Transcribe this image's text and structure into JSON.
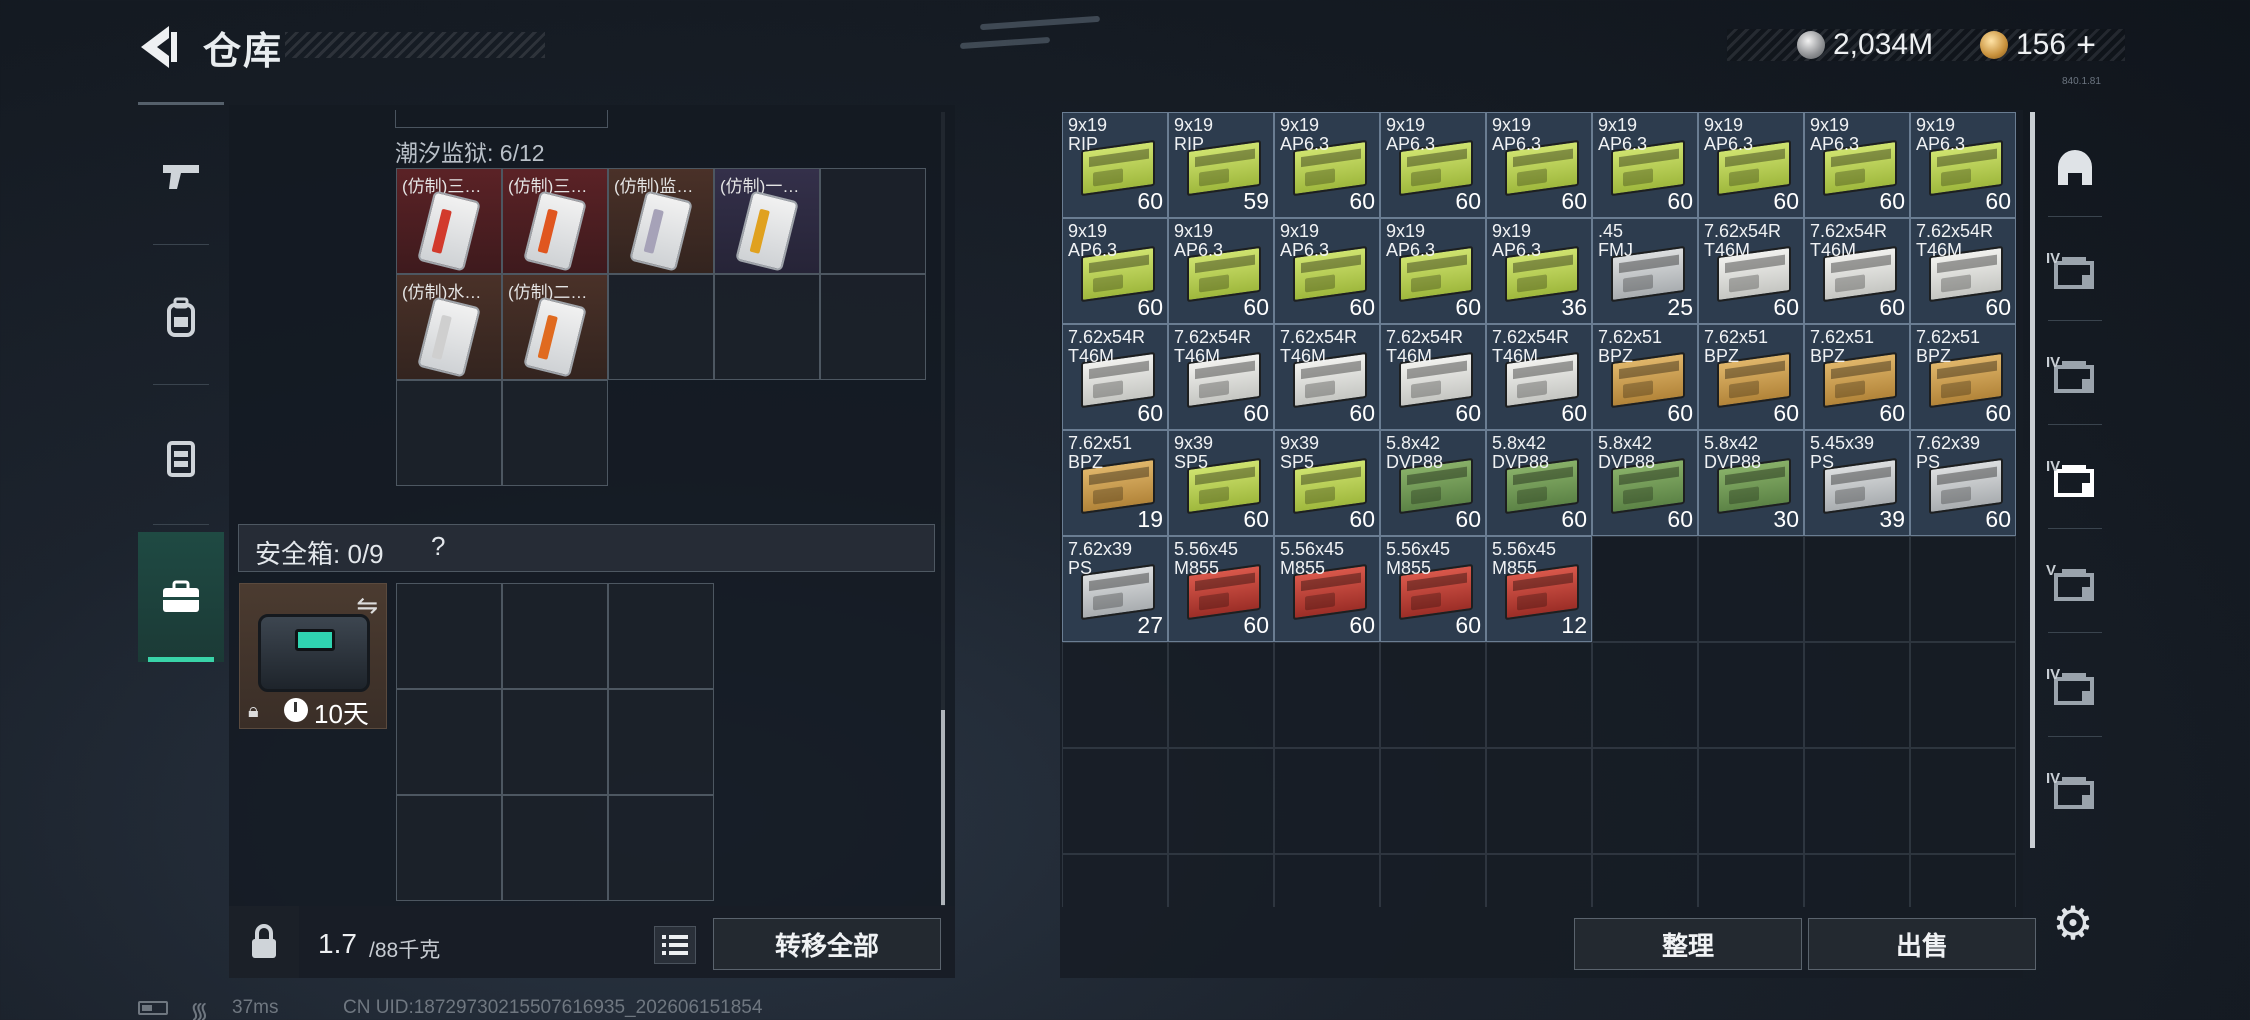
{
  "header": {
    "title": "仓库",
    "currencies": {
      "silver": "2,034M",
      "gold": "156",
      "plus": "+"
    },
    "version": "840.1.81"
  },
  "left_rail": {
    "tabs": [
      {
        "icon": "pistol-icon",
        "active": false
      },
      {
        "icon": "backpack-icon",
        "active": false
      },
      {
        "icon": "chest-rig-icon",
        "active": false
      },
      {
        "icon": "briefcase-icon",
        "active": true
      }
    ]
  },
  "container": {
    "label": "潮汐监狱: 6/12",
    "items": [
      {
        "name": "(仿制)三…",
        "bg": "red",
        "strip": "#d23a2c"
      },
      {
        "name": "(仿制)三…",
        "bg": "red",
        "strip": "#e0561f"
      },
      {
        "name": "(仿制)监…",
        "bg": "brown",
        "strip": "#a6a2b8"
      },
      {
        "name": "(仿制)一…",
        "bg": "purple",
        "strip": "#e0a11f"
      },
      {
        "name": "(仿制)水…",
        "bg": "brown",
        "strip": "#cfcfcf"
      },
      {
        "name": "(仿制)二…",
        "bg": "brown",
        "strip": "#e06a1f"
      }
    ]
  },
  "safe_box": {
    "label": "安全箱: 0/9",
    "help": "?",
    "timer": "10天",
    "swap_icon": "swap-icon",
    "lock_icon": "lock-icon"
  },
  "weight": {
    "value": "1.7",
    "max": "/88千克"
  },
  "buttons": {
    "transfer_all": "转移全部",
    "sort": "整理",
    "sell": "出售"
  },
  "ammo_items": [
    {
      "cal": "9x19",
      "var": "RIP",
      "count": "60",
      "color": "lime"
    },
    {
      "cal": "9x19",
      "var": "RIP",
      "count": "59",
      "color": "lime"
    },
    {
      "cal": "9x19",
      "var": "AP6.3",
      "count": "60",
      "color": "lime"
    },
    {
      "cal": "9x19",
      "var": "AP6.3",
      "count": "60",
      "color": "lime"
    },
    {
      "cal": "9x19",
      "var": "AP6.3",
      "count": "60",
      "color": "lime"
    },
    {
      "cal": "9x19",
      "var": "AP6.3",
      "count": "60",
      "color": "lime"
    },
    {
      "cal": "9x19",
      "var": "AP6.3",
      "count": "60",
      "color": "lime"
    },
    {
      "cal": "9x19",
      "var": "AP6.3",
      "count": "60",
      "color": "lime"
    },
    {
      "cal": "9x19",
      "var": "AP6.3",
      "count": "60",
      "color": "lime"
    },
    {
      "cal": "9x19",
      "var": "AP6.3",
      "count": "60",
      "color": "lime"
    },
    {
      "cal": "9x19",
      "var": "AP6.3",
      "count": "60",
      "color": "lime"
    },
    {
      "cal": "9x19",
      "var": "AP6.3",
      "count": "60",
      "color": "lime"
    },
    {
      "cal": "9x19",
      "var": "AP6.3",
      "count": "60",
      "color": "lime"
    },
    {
      "cal": "9x19",
      "var": "AP6.3",
      "count": "36",
      "color": "lime"
    },
    {
      "cal": ".45",
      "var": "FMJ",
      "count": "25",
      "color": "grey"
    },
    {
      "cal": "7.62x54R",
      "var": "T46M",
      "count": "60",
      "color": "white"
    },
    {
      "cal": "7.62x54R",
      "var": "T46M",
      "count": "60",
      "color": "white"
    },
    {
      "cal": "7.62x54R",
      "var": "T46M",
      "count": "60",
      "color": "white"
    },
    {
      "cal": "7.62x54R",
      "var": "T46M",
      "count": "60",
      "color": "white"
    },
    {
      "cal": "7.62x54R",
      "var": "T46M",
      "count": "60",
      "color": "white"
    },
    {
      "cal": "7.62x54R",
      "var": "T46M",
      "count": "60",
      "color": "white"
    },
    {
      "cal": "7.62x54R",
      "var": "T46M",
      "count": "60",
      "color": "white"
    },
    {
      "cal": "7.62x54R",
      "var": "T46M",
      "count": "60",
      "color": "white"
    },
    {
      "cal": "7.62x51",
      "var": "BPZ",
      "count": "60",
      "color": "tan"
    },
    {
      "cal": "7.62x51",
      "var": "BPZ",
      "count": "60",
      "color": "tan"
    },
    {
      "cal": "7.62x51",
      "var": "BPZ",
      "count": "60",
      "color": "tan"
    },
    {
      "cal": "7.62x51",
      "var": "BPZ",
      "count": "60",
      "color": "tan"
    },
    {
      "cal": "7.62x51",
      "var": "BPZ",
      "count": "19",
      "color": "tan"
    },
    {
      "cal": "9x39",
      "var": "SP5",
      "count": "60",
      "color": "lime"
    },
    {
      "cal": "9x39",
      "var": "SP5",
      "count": "60",
      "color": "lime"
    },
    {
      "cal": "5.8x42",
      "var": "DVP88",
      "count": "60",
      "color": "green"
    },
    {
      "cal": "5.8x42",
      "var": "DVP88",
      "count": "60",
      "color": "green"
    },
    {
      "cal": "5.8x42",
      "var": "DVP88",
      "count": "60",
      "color": "green"
    },
    {
      "cal": "5.8x42",
      "var": "DVP88",
      "count": "30",
      "color": "green"
    },
    {
      "cal": "5.45x39",
      "var": "PS",
      "count": "39",
      "color": "grey"
    },
    {
      "cal": "7.62x39",
      "var": "PS",
      "count": "60",
      "color": "grey"
    },
    {
      "cal": "7.62x39",
      "var": "PS",
      "count": "27",
      "color": "grey"
    },
    {
      "cal": "5.56x45",
      "var": "M855",
      "count": "60",
      "color": "red"
    },
    {
      "cal": "5.56x45",
      "var": "M855",
      "count": "60",
      "color": "red"
    },
    {
      "cal": "5.56x45",
      "var": "M855",
      "count": "60",
      "color": "red"
    },
    {
      "cal": "5.56x45",
      "var": "M855",
      "count": "12",
      "color": "red"
    }
  ],
  "right_rail": {
    "tabs": [
      {
        "icon": "helmet-icon",
        "tier": ""
      },
      {
        "icon": "ammo-crate-icon",
        "tier": "IV"
      },
      {
        "icon": "ammo-crate-icon",
        "tier": "IV"
      },
      {
        "icon": "ammo-crate-icon",
        "tier": "IV"
      },
      {
        "icon": "gear-crate-icon",
        "tier": "V"
      },
      {
        "icon": "gear-crate-icon",
        "tier": "IV"
      },
      {
        "icon": "warning-crate-icon",
        "tier": "IV"
      }
    ]
  },
  "status": {
    "ping": "37ms",
    "uid": "CN UID:187297302155076169​35_202606151854"
  }
}
